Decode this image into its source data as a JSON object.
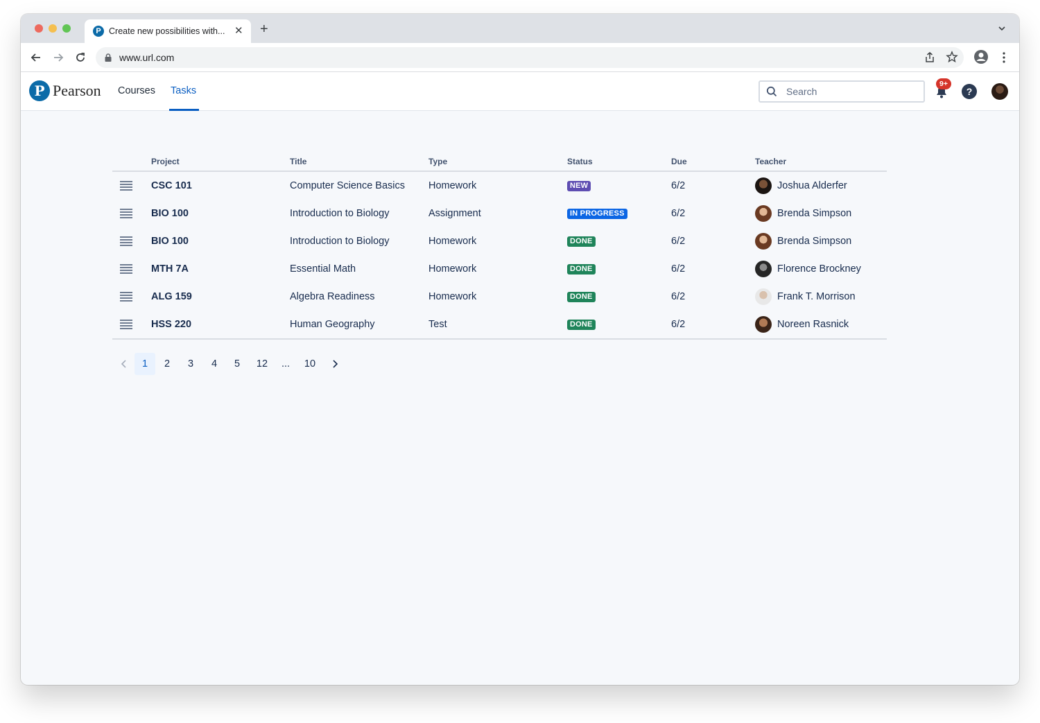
{
  "browser": {
    "tab_title": "Create new possibilities with...",
    "tab_favicon": "P",
    "url": "www.url.com"
  },
  "app": {
    "logo_mark": "P",
    "logo_text": "Pearson",
    "nav": [
      {
        "label": "Courses",
        "active": false
      },
      {
        "label": "Tasks",
        "active": true
      }
    ],
    "search_placeholder": "Search",
    "notification_badge": "9+",
    "help_label": "?"
  },
  "table": {
    "columns": [
      "Project",
      "Title",
      "Type",
      "Status",
      "Due",
      "Teacher"
    ],
    "rows": [
      {
        "project": "CSC 101",
        "title": "Computer Science Basics",
        "type": "Homework",
        "status": "NEW",
        "due": "6/2",
        "teacher": "Joshua Alderfer"
      },
      {
        "project": "BIO 100",
        "title": "Introduction to Biology",
        "type": "Assignment",
        "status": "IN PROGRESS",
        "due": "6/2",
        "teacher": "Brenda Simpson"
      },
      {
        "project": "BIO 100",
        "title": "Introduction to Biology",
        "type": "Homework",
        "status": "DONE",
        "due": "6/2",
        "teacher": "Brenda Simpson"
      },
      {
        "project": "MTH 7A",
        "title": "Essential Math",
        "type": "Homework",
        "status": "DONE",
        "due": "6/2",
        "teacher": "Florence Brockney"
      },
      {
        "project": "ALG 159",
        "title": "Algebra Readiness",
        "type": "Homework",
        "status": "DONE",
        "due": "6/2",
        "teacher": "Frank T. Morrison"
      },
      {
        "project": "HSS 220",
        "title": "Human Geography",
        "type": "Test",
        "status": "DONE",
        "due": "6/2",
        "teacher": "Noreen Rasnick"
      }
    ]
  },
  "status_colors": {
    "NEW": "#5e4db2",
    "IN PROGRESS": "#0c66e4",
    "DONE": "#1f845a"
  },
  "pagination": {
    "pages": [
      "1",
      "2",
      "3",
      "4",
      "5",
      "12",
      "...",
      "10"
    ],
    "current": "1"
  },
  "colors": {
    "accent": "#0a5ec2",
    "brand": "#0c6ba8",
    "badge": "#d5342a"
  }
}
